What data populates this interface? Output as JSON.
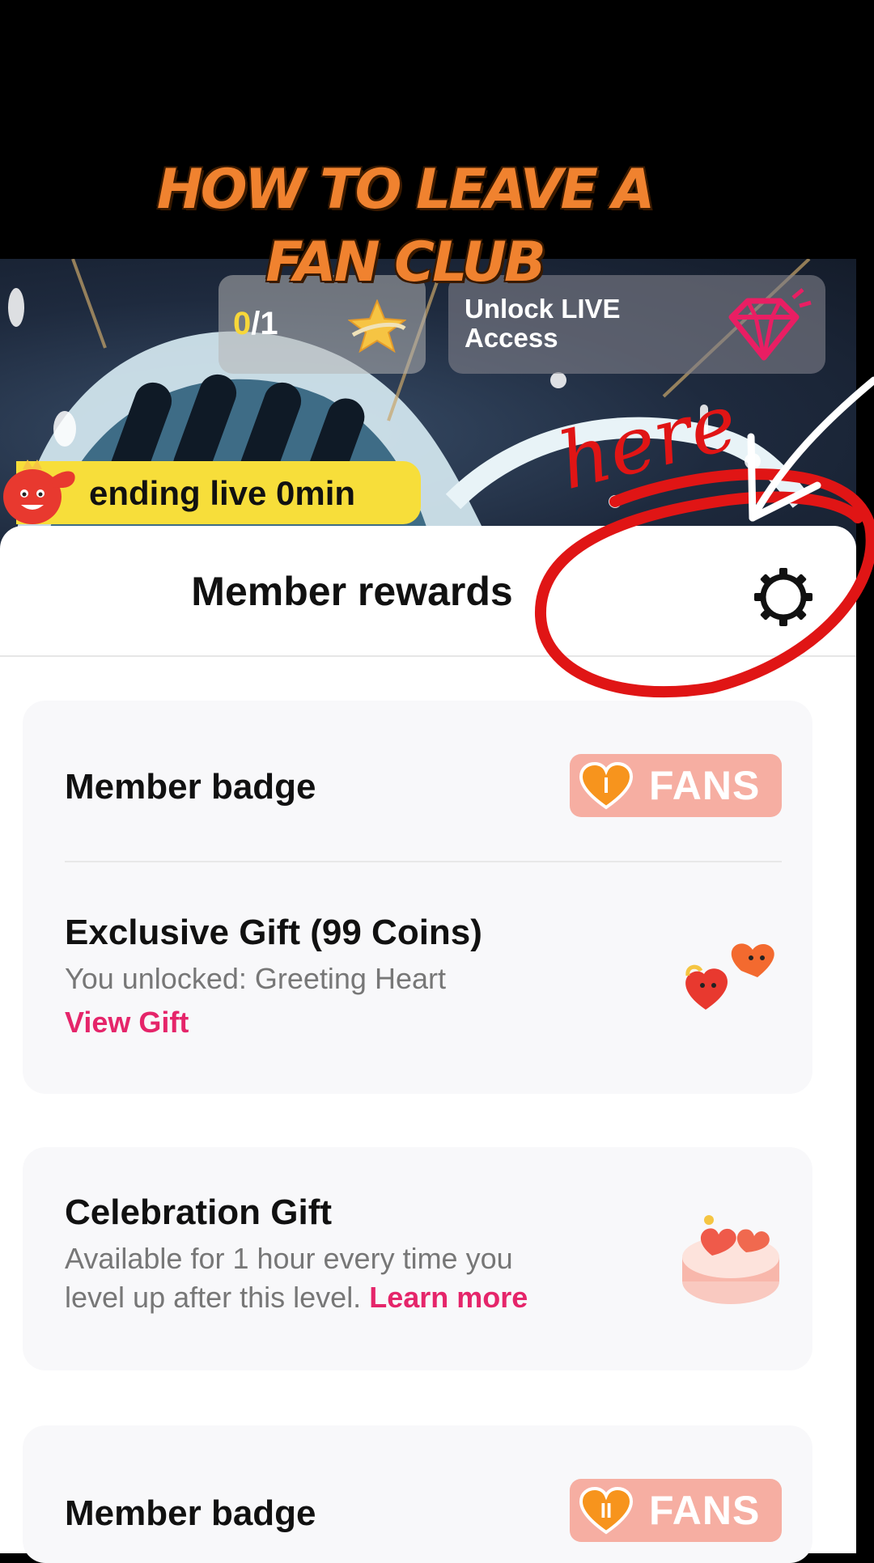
{
  "overlay": {
    "title_line1": "HOW TO LEAVE A",
    "title_line2": "FAN CLUB",
    "annotation_text": "here",
    "annotation_color": "#e01515"
  },
  "banner": {
    "progress_current": "0",
    "progress_total": "/1",
    "unlock_text": "Unlock LIVE Access",
    "ending_text": "ending live 0min",
    "icons": [
      "star-icon",
      "gem-icon",
      "mascot-icon"
    ]
  },
  "sheet": {
    "title": "Member rewards",
    "settings_icon": "gear-icon",
    "cards": {
      "first": {
        "badge_row": {
          "title": "Member badge",
          "badge_level": "I",
          "badge_label": "FANS"
        },
        "gift_row": {
          "title": "Exclusive Gift (99 Coins)",
          "subtitle": "You unlocked: Greeting Heart",
          "link": "View Gift"
        }
      },
      "celebration": {
        "title": "Celebration Gift",
        "subtitle_line1": "Available for 1 hour every time you",
        "subtitle_line2": "level up after this level.",
        "link": "Learn more"
      },
      "second_badge": {
        "title": "Member badge",
        "badge_level": "II",
        "badge_label": "FANS"
      }
    }
  },
  "colors": {
    "accent_pink": "#e5256a",
    "badge_bg": "#f6aea2",
    "banner_yellow": "#f7de3a",
    "title_orange": "#f0822f"
  }
}
